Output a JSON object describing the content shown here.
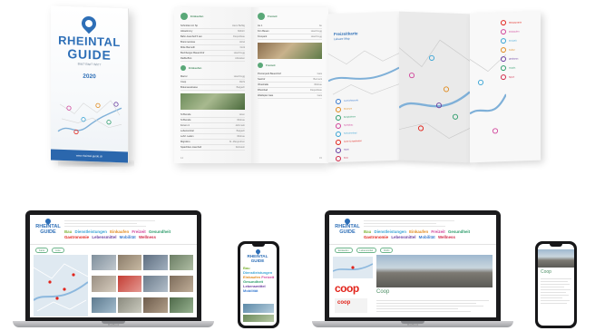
{
  "cover": {
    "brand_line1": "RHEINTAL",
    "brand_line2": "GUIDE",
    "tagline": "Bist? Bist? Wir!?",
    "year": "2020",
    "footer_url": "www.rheintal-guide.ch"
  },
  "brochure": {
    "left_section": "Einkaufen",
    "right_section": "Freizeit",
    "left_rows": [
      {
        "name": "Schmitten Al. Sp",
        "right": "Hans Bahlig"
      },
      {
        "name": "Alstacimmy",
        "right": "Mitfuhr"
      },
      {
        "name": "Bahn-Asenhell 5 sen",
        "right": "Diepoldsau"
      },
      {
        "name": "Brammenstau",
        "right": "Hirtel"
      },
      {
        "name": "Mitte Bannoth",
        "right": "Dotti"
      },
      {
        "name": "Buchberger-Bauernhof",
        "right": "Heerbrugg"
      },
      {
        "name": "Raiffa-Brot",
        "right": "Altstatten"
      }
    ],
    "left_rows2": [
      {
        "name": "Marrer",
        "right": "Heerbrugg"
      },
      {
        "name": "Coop",
        "right": "Rüthi"
      },
      {
        "name": "Bräumaustrasse",
        "right": "Balgach"
      }
    ],
    "left_rows3": [
      {
        "name": "St Bumde",
        "right": "Hoen"
      },
      {
        "name": "St Bumde",
        "right": "Widnau"
      },
      {
        "name": "Forum 4",
        "right": "Jahrnseb"
      },
      {
        "name": "Lebensmittel",
        "right": "Balgach"
      },
      {
        "name": "Lehrl. Laden",
        "right": "Widnau"
      },
      {
        "name": "Migrolino",
        "right": "St.-Margrethen"
      },
      {
        "name": "Spaichtien-Asenhell",
        "right": "Rebstein"
      }
    ],
    "right_rows": [
      {
        "name": "Au 1",
        "right": "Au"
      },
      {
        "name": "Kim Besan",
        "right": "Heerbrugg"
      },
      {
        "name": "Kinopark",
        "right": "Heerbrugg"
      }
    ],
    "right_rows2": [
      {
        "name": "Pionierpark Bauernhof",
        "right": "Gais"
      },
      {
        "name": "Seehof",
        "right": "Berneck"
      },
      {
        "name": "Vibeshalle",
        "right": "Widnau"
      },
      {
        "name": "Rheinbad",
        "right": "Diepoldsau"
      },
      {
        "name": "Waldspiel Gais",
        "right": "Gais"
      }
    ],
    "left_page_no": "14",
    "right_page_no": "15"
  },
  "foldmap": {
    "title": "Freizeitkarte",
    "subtitle": "Leisure Map",
    "legend_right": [
      {
        "label": "Restaurants",
        "color": "#e2231a"
      },
      {
        "label": "Einkaufen",
        "color": "#d1459b"
      },
      {
        "label": "Freizeit",
        "color": "#3aa4d5"
      },
      {
        "label": "Kultur",
        "color": "#e08b1f"
      },
      {
        "label": "Wellness",
        "color": "#6b3fa0"
      },
      {
        "label": "Hotels",
        "color": "#2e9d6c"
      },
      {
        "label": "Sport",
        "color": "#d12a4a"
      }
    ],
    "legend_left": [
      {
        "label": "Aussichtspunkt",
        "color": "#3c7dd1"
      },
      {
        "label": "Museum",
        "color": "#e08b1f"
      },
      {
        "label": "Bergbahnen",
        "color": "#2e9d6c"
      },
      {
        "label": "Spielplatz",
        "color": "#d1459b"
      },
      {
        "label": "Schwimmbad",
        "color": "#3aa4d5"
      },
      {
        "label": "Ärzte & Apotheken",
        "color": "#e2231a"
      },
      {
        "label": "Hotel",
        "color": "#6b3fa0"
      },
      {
        "label": "Kino",
        "color": "#d12a4a"
      }
    ]
  },
  "site": {
    "logo_line1": "RHEINTAL",
    "logo_line2": "GUIDE",
    "categories": [
      {
        "label": "Bau",
        "color": "#7fb539"
      },
      {
        "label": "Dienstleistungen",
        "color": "#3aa4d5"
      },
      {
        "label": "Einkaufen",
        "color": "#e08b1f"
      },
      {
        "label": "Freizeit",
        "color": "#d1459b"
      },
      {
        "label": "Gesundheit",
        "color": "#2e9d6c"
      },
      {
        "label": "Gastronomie",
        "color": "#e2231a"
      },
      {
        "label": "Lebensmittel",
        "color": "#6b3fa0"
      },
      {
        "label": "Mobilität",
        "color": "#3c7dd1"
      },
      {
        "label": "Wellness",
        "color": "#d12a4a"
      }
    ],
    "map_tabs": [
      "Karte",
      "Liste"
    ],
    "laptop_label": "MacBook",
    "detail_tabs": [
      "Einkaufen",
      "Lebensmittel",
      "Rüthi"
    ],
    "detail_title": "Coop",
    "coop_logo": "coop"
  },
  "phone1": {
    "logo_line1": "RHEINTAL",
    "logo_line2": "GUIDE",
    "categories": [
      "Bau",
      "Dienstleistungen",
      "Einkaufen",
      "Freizeit",
      "Gesundheit",
      "Lebensmittel",
      "Mobilität"
    ]
  },
  "phone2": {
    "title": "Coop"
  }
}
